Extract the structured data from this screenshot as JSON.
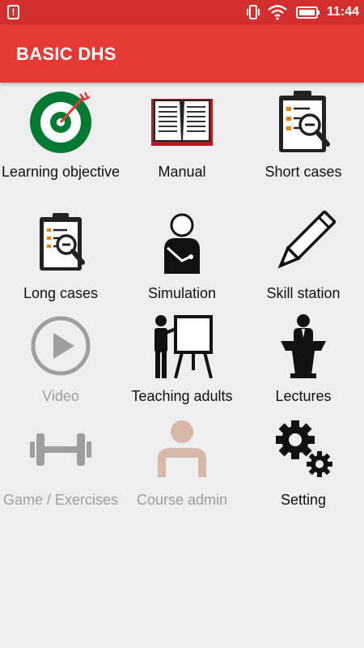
{
  "status_bar": {
    "time": "11:44",
    "icons": [
      "alert-icon",
      "vibrate-icon",
      "wifi-icon",
      "battery-icon"
    ]
  },
  "app_bar": {
    "title": "BASIC DHS"
  },
  "colors": {
    "status_bar": "#d32f2f",
    "app_bar": "#e53935",
    "background": "#eeeeee",
    "disabled_text": "#9e9e9e",
    "target_green": "#007a33"
  },
  "menu": [
    {
      "label": "Learning objective",
      "icon": "target-icon",
      "enabled": true
    },
    {
      "label": "Manual",
      "icon": "book-icon",
      "enabled": true
    },
    {
      "label": "Short cases",
      "icon": "clipboard-magnifier-icon",
      "enabled": true
    },
    {
      "label": "Long cases",
      "icon": "clipboard-magnifier-icon",
      "enabled": true
    },
    {
      "label": "Simulation",
      "icon": "patient-icon",
      "enabled": true
    },
    {
      "label": "Skill station",
      "icon": "pencil-icon",
      "enabled": true
    },
    {
      "label": "Video",
      "icon": "play-icon",
      "enabled": false
    },
    {
      "label": "Teaching adults",
      "icon": "teacher-icon",
      "enabled": true
    },
    {
      "label": "Lectures",
      "icon": "lectern-icon",
      "enabled": true
    },
    {
      "label": "Game / Exercises",
      "icon": "dumbbell-icon",
      "enabled": false
    },
    {
      "label": "Course admin",
      "icon": "admin-person-icon",
      "enabled": false
    },
    {
      "label": "Setting",
      "icon": "gears-icon",
      "enabled": true
    }
  ]
}
